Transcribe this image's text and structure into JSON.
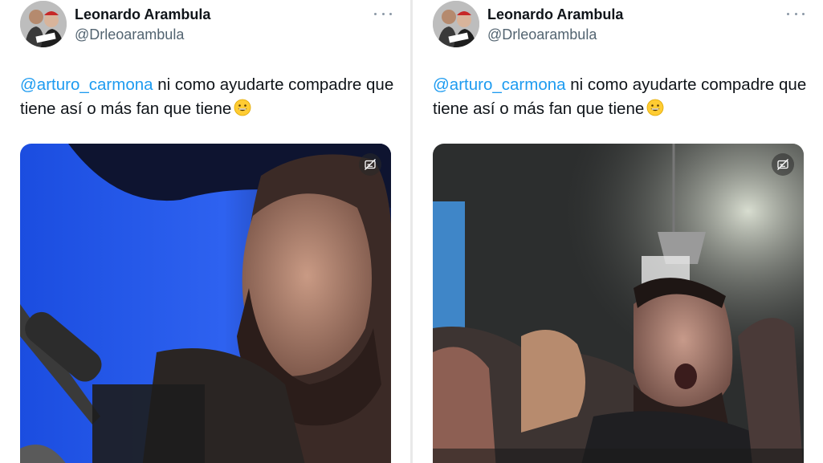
{
  "tweets": [
    {
      "author": {
        "name": "Leonardo Arambula",
        "handle": "@Drleoarambula"
      },
      "text": {
        "mention": "@arturo_carmona",
        "body": " ni como ayudarte compadre que tiene así o más fan que tiene"
      },
      "emoji_icon": "grinning-face-icon",
      "more_icon": "ellipsis-icon",
      "media_overlay_icon": "subtitles-off-icon"
    },
    {
      "author": {
        "name": "Leonardo Arambula",
        "handle": "@Drleoarambula"
      },
      "text": {
        "mention": "@arturo_carmona",
        "body": " ni como ayudarte compadre que tiene así o más fan que tiene"
      },
      "emoji_icon": "grinning-face-icon",
      "more_icon": "ellipsis-icon",
      "media_overlay_icon": "subtitles-off-icon"
    }
  ],
  "colors": {
    "mention": "#1d9bf0",
    "handle": "#536471",
    "text": "#0f1419"
  }
}
